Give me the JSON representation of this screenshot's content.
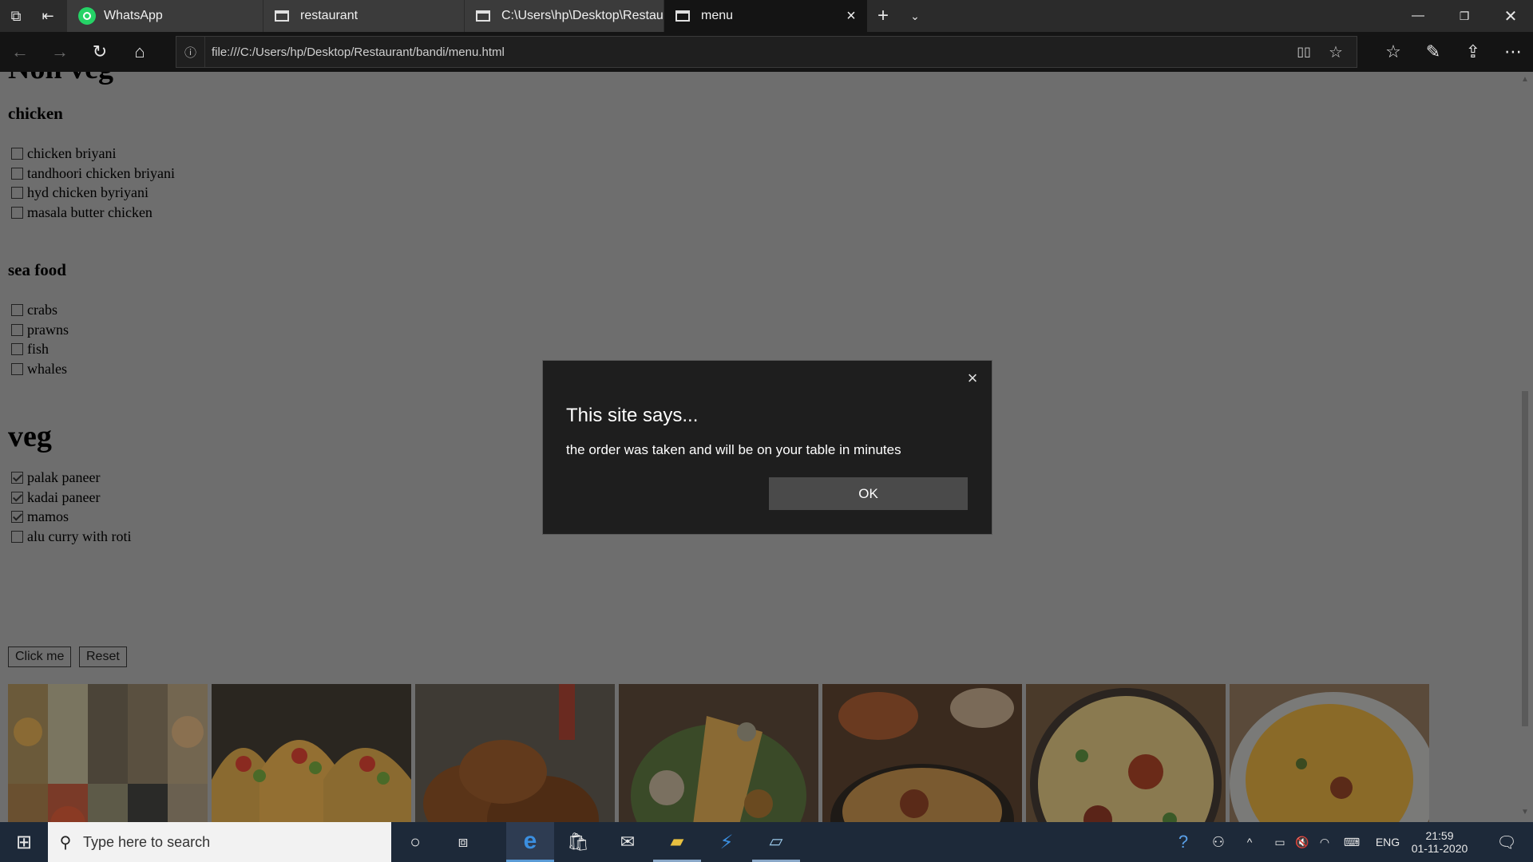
{
  "browser": {
    "tabs": [
      {
        "label": "WhatsApp"
      },
      {
        "label": "restaurant"
      },
      {
        "label": "C:\\Users\\hp\\Desktop\\Restau"
      },
      {
        "label": "menu"
      }
    ],
    "address": "file:///C:/Users/hp/Desktop/Restaurant/bandi/menu.html"
  },
  "page": {
    "nonveg_heading": "Non veg",
    "chicken_heading": "chicken",
    "chicken_items": [
      {
        "label": "chicken briyani",
        "checked": false
      },
      {
        "label": "tandhoori chicken briyani",
        "checked": false
      },
      {
        "label": "hyd chicken byriyani",
        "checked": false
      },
      {
        "label": "masala butter chicken",
        "checked": false
      }
    ],
    "seafood_heading": "sea food",
    "seafood_items": [
      {
        "label": "crabs",
        "checked": false
      },
      {
        "label": "prawns",
        "checked": false
      },
      {
        "label": "fish",
        "checked": false
      },
      {
        "label": "whales",
        "checked": false
      }
    ],
    "veg_heading": "veg",
    "veg_items": [
      {
        "label": "palak paneer",
        "checked": true
      },
      {
        "label": "kadai paneer",
        "checked": true
      },
      {
        "label": "mamos",
        "checked": true
      },
      {
        "label": "alu curry with roti",
        "checked": false
      }
    ],
    "click_button": "Click me",
    "reset_button": "Reset",
    "images": [
      "food-collage",
      "tacos",
      "fried-chicken",
      "dosa-plate",
      "biryani-pot",
      "chicken-biryani",
      "biryani-plate"
    ]
  },
  "dialog": {
    "title": "This site says...",
    "message": "the order was taken and will be on your table in minutes",
    "ok_label": "OK"
  },
  "taskbar": {
    "search_placeholder": "Type here to search",
    "language": "ENG",
    "time": "21:59",
    "date": "01-11-2020"
  }
}
